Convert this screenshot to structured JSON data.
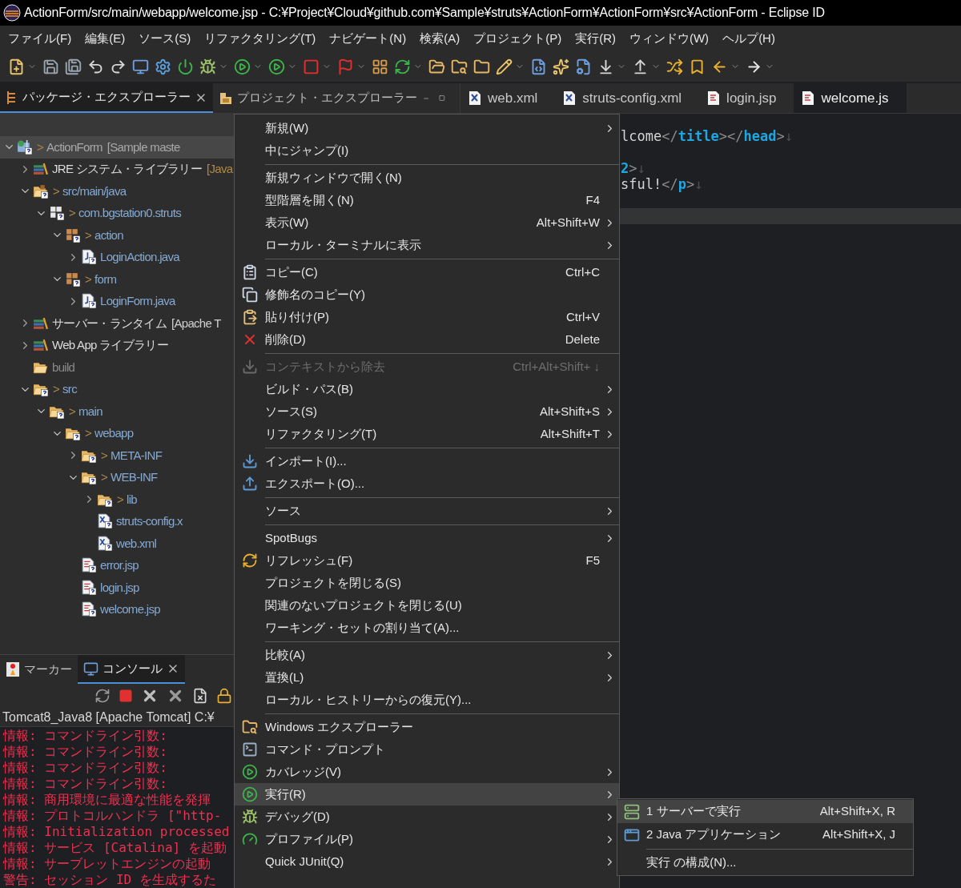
{
  "window": {
    "title": "ActionForm/src/main/webapp/welcome.jsp - C:¥Project¥Cloud¥github.com¥Sample¥struts¥ActionForm¥ActionForm¥src¥ActionForm - Eclipse ID"
  },
  "menu_bar": [
    "ファイル(F)",
    "編集(E)",
    "ソース(S)",
    "リファクタリング(T)",
    "ナビゲート(N)",
    "検索(A)",
    "プロジェクト(P)",
    "実行(R)",
    "ウィンドウ(W)",
    "ヘルプ(H)"
  ],
  "left_tabs": [
    {
      "label": "パッケージ・エクスプローラー",
      "selected": true,
      "closable": true
    },
    {
      "label": "プロジェクト・エクスプローラー",
      "selected": false,
      "closable": false
    }
  ],
  "tree": [
    {
      "label": "ActionForm",
      "prefix": ">",
      "decoration": "[Sample maste",
      "kind": "project",
      "expanded": true,
      "selected": true,
      "children": [
        {
          "label": "JRE システム・ライブラリー",
          "decoration": "[Java",
          "kind": "library",
          "expanded": false,
          "selected": false
        },
        {
          "label": "src/main/java",
          "prefix": ">",
          "kind": "srcfolder",
          "expanded": true,
          "selected": false,
          "children": [
            {
              "label": "com.bgstation0.struts",
              "prefix": ">",
              "kind": "package-empty",
              "expanded": true,
              "selected": false,
              "children": [
                {
                  "label": "action",
                  "prefix": ">",
                  "kind": "package",
                  "expanded": true,
                  "selected": false,
                  "children": [
                    {
                      "label": "LoginAction.java",
                      "kind": "java",
                      "expanded": false,
                      "selected": false
                    }
                  ]
                },
                {
                  "label": "form",
                  "prefix": ">",
                  "kind": "package",
                  "expanded": true,
                  "selected": false,
                  "children": [
                    {
                      "label": "LoginForm.java",
                      "kind": "java",
                      "expanded": false,
                      "selected": false
                    }
                  ]
                }
              ]
            }
          ]
        },
        {
          "label": "サーバー・ランタイム",
          "decoration": "[Apache T",
          "kind": "runtime",
          "expanded": false,
          "selected": false
        },
        {
          "label": "Web App ライブラリー",
          "kind": "runtime",
          "expanded": false,
          "selected": false
        },
        {
          "label": "build",
          "kind": "ignored-folder",
          "selected": false
        },
        {
          "label": "src",
          "prefix": ">",
          "kind": "folder",
          "expanded": true,
          "selected": false,
          "children": [
            {
              "label": "main",
              "prefix": ">",
              "kind": "folder",
              "expanded": true,
              "selected": false,
              "children": [
                {
                  "label": "webapp",
                  "prefix": ">",
                  "kind": "folder",
                  "expanded": true,
                  "selected": false,
                  "children": [
                    {
                      "label": "META-INF",
                      "prefix": ">",
                      "kind": "folder",
                      "expanded": false,
                      "selected": false
                    },
                    {
                      "label": "WEB-INF",
                      "prefix": ">",
                      "kind": "folder",
                      "expanded": true,
                      "selected": false,
                      "children": [
                        {
                          "label": "lib",
                          "prefix": ">",
                          "kind": "folder",
                          "expanded": false,
                          "selected": false
                        },
                        {
                          "label": "struts-config.x",
                          "kind": "xml",
                          "selected": false
                        },
                        {
                          "label": "web.xml",
                          "kind": "xml",
                          "selected": false
                        }
                      ]
                    },
                    {
                      "label": "error.jsp",
                      "kind": "jsp",
                      "selected": false
                    },
                    {
                      "label": "login.jsp",
                      "kind": "jsp",
                      "selected": false
                    },
                    {
                      "label": "welcome.jsp",
                      "kind": "jsp",
                      "selected": false
                    }
                  ]
                }
              ]
            }
          ]
        }
      ]
    }
  ],
  "editor_tabs": [
    {
      "label": "web.xml",
      "kind": "xml",
      "selected": false
    },
    {
      "label": "struts-config.xml",
      "kind": "xml",
      "selected": false
    },
    {
      "label": "login.jsp",
      "kind": "jsp",
      "selected": false
    },
    {
      "label": "welcome.js",
      "kind": "jsp",
      "selected": true
    }
  ],
  "editor": {
    "lines": [
      {
        "current": false,
        "tokens": [
          {
            "t": "lcome",
            "kind": "text"
          },
          {
            "t": "</",
            "kind": "punct"
          },
          {
            "t": "title",
            "kind": "tag"
          },
          {
            "t": "></",
            "kind": "punct"
          },
          {
            "t": "head",
            "kind": "tag"
          },
          {
            "t": ">",
            "kind": "punct"
          },
          {
            "t": "↓",
            "kind": "eol"
          }
        ]
      },
      {
        "current": false
      },
      {
        "current": false,
        "tokens": [
          {
            "t": "2",
            "kind": "tag"
          },
          {
            "t": ">",
            "kind": "punct"
          },
          {
            "t": "↓",
            "kind": "eol"
          }
        ]
      },
      {
        "current": false,
        "tokens": [
          {
            "t": "sful!",
            "kind": "text"
          },
          {
            "t": "</",
            "kind": "punct"
          },
          {
            "t": "p",
            "kind": "tag"
          },
          {
            "t": ">",
            "kind": "punct"
          },
          {
            "t": "↓",
            "kind": "eol"
          }
        ]
      },
      {
        "current": false
      },
      {
        "current": true
      }
    ]
  },
  "bottom_tabs": [
    {
      "label": "マーカー",
      "selected": false,
      "closable": false
    },
    {
      "label": "コンソール",
      "selected": true,
      "closable": true
    }
  ],
  "console": {
    "header": "Tomcat8_Java8 [Apache Tomcat] C:¥",
    "lines": [
      "情報: コマンドライン引数:",
      "情報: コマンドライン引数:",
      "情報: コマンドライン引数:",
      "情報: コマンドライン引数:",
      "情報: 商用環境に最適な性能を発揮",
      "情報: プロトコルハンドラ [\"http-",
      "情報: Initialization processed ",
      "情報: サービス [Catalina] を起動",
      "情報: サーブレットエンジンの起動",
      "警告: セッション ID を生成するた"
    ]
  },
  "context_menu": {
    "sections": [
      [
        {
          "label": "新規(W)",
          "submenu": true,
          "disabled": false,
          "selected": false
        },
        {
          "label": "中にジャンプ(I)",
          "submenu": false,
          "disabled": false,
          "selected": false
        }
      ],
      [
        {
          "label": "新規ウィンドウで開く(N)",
          "submenu": false,
          "disabled": false,
          "selected": false
        },
        {
          "label": "型階層を開く(N)",
          "shortcut": "F4",
          "submenu": false,
          "disabled": false,
          "selected": false
        },
        {
          "label": "表示(W)",
          "shortcut": "Alt+Shift+W",
          "submenu": true,
          "disabled": false,
          "selected": false
        },
        {
          "label": "ローカル・ターミナルに表示",
          "submenu": true,
          "disabled": false,
          "selected": false
        }
      ],
      [
        {
          "label": "コピー(C)",
          "shortcut": "Ctrl+C",
          "submenu": false,
          "disabled": false,
          "selected": false
        },
        {
          "label": "修飾名のコピー(Y)",
          "submenu": false,
          "disabled": false,
          "selected": false
        },
        {
          "label": "貼り付け(P)",
          "shortcut": "Ctrl+V",
          "submenu": false,
          "disabled": false,
          "selected": false
        },
        {
          "label": "削除(D)",
          "shortcut": "Delete",
          "submenu": false,
          "disabled": false,
          "selected": false
        }
      ],
      [
        {
          "label": "コンテキストから除去",
          "shortcut": "Ctrl+Alt+Shift+ ↓",
          "submenu": false,
          "disabled": true,
          "selected": false
        },
        {
          "label": "ビルド・パス(B)",
          "submenu": true,
          "disabled": false,
          "selected": false
        },
        {
          "label": "ソース(S)",
          "shortcut": "Alt+Shift+S",
          "submenu": true,
          "disabled": false,
          "selected": false
        },
        {
          "label": "リファクタリング(T)",
          "shortcut": "Alt+Shift+T",
          "submenu": true,
          "disabled": false,
          "selected": false
        }
      ],
      [
        {
          "label": "インポート(I)...",
          "submenu": false,
          "disabled": false,
          "selected": false
        },
        {
          "label": "エクスポート(O)...",
          "submenu": false,
          "disabled": false,
          "selected": false
        }
      ],
      [
        {
          "label": "ソース",
          "submenu": true,
          "disabled": false,
          "selected": false
        }
      ],
      [
        {
          "label": "SpotBugs",
          "submenu": true,
          "disabled": false,
          "selected": false
        },
        {
          "label": "リフレッシュ(F)",
          "shortcut": "F5",
          "submenu": false,
          "disabled": false,
          "selected": false
        },
        {
          "label": "プロジェクトを閉じる(S)",
          "submenu": false,
          "disabled": false,
          "selected": false
        },
        {
          "label": "関連のないプロジェクトを閉じる(U)",
          "submenu": false,
          "disabled": false,
          "selected": false
        },
        {
          "label": "ワーキング・セットの割り当て(A)...",
          "submenu": false,
          "disabled": false,
          "selected": false
        }
      ],
      [
        {
          "label": "比較(A)",
          "submenu": true,
          "disabled": false,
          "selected": false
        },
        {
          "label": "置換(L)",
          "submenu": true,
          "disabled": false,
          "selected": false
        },
        {
          "label": "ローカル・ヒストリーからの復元(Y)...",
          "submenu": false,
          "disabled": false,
          "selected": false
        }
      ],
      [
        {
          "label": "Windows エクスプローラー",
          "submenu": false,
          "disabled": false,
          "selected": false
        },
        {
          "label": "コマンド・プロンプト",
          "submenu": false,
          "disabled": false,
          "selected": false
        },
        {
          "label": "カバレッジ(V)",
          "submenu": true,
          "disabled": false,
          "selected": false
        },
        {
          "label": "実行(R)",
          "submenu": true,
          "disabled": false,
          "selected": true
        },
        {
          "label": "デバッグ(D)",
          "submenu": true,
          "disabled": false,
          "selected": false
        },
        {
          "label": "プロファイル(P)",
          "submenu": true,
          "disabled": false,
          "selected": false
        },
        {
          "label": "Quick JUnit(Q)",
          "submenu": true,
          "disabled": false,
          "selected": false
        }
      ]
    ]
  },
  "submenu": {
    "sections": [
      [
        {
          "label": "1 サーバーで実行",
          "shortcut": "Alt+Shift+X, R",
          "selected": true
        },
        {
          "label": "2 Java アプリケーション",
          "shortcut": "Alt+Shift+X, J",
          "selected": false
        }
      ],
      [
        {
          "label": "実行 の構成(N)...",
          "selected": false
        }
      ]
    ]
  }
}
